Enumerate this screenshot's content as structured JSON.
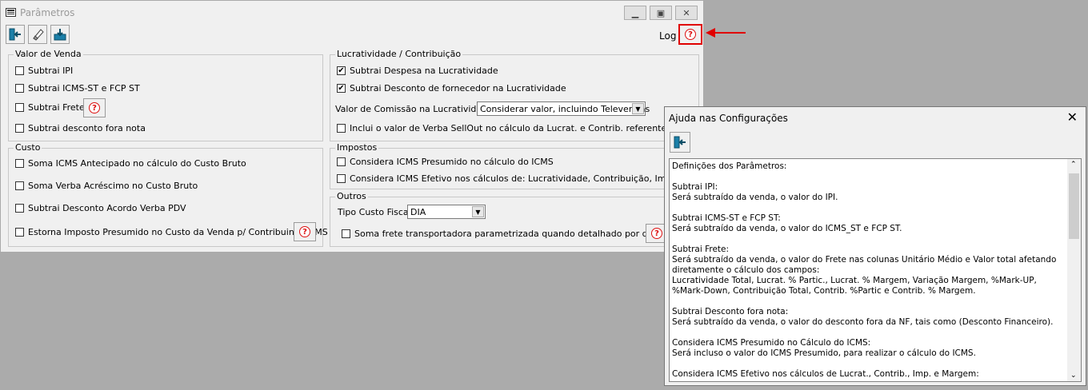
{
  "window": {
    "title": "Parâmetros"
  },
  "toolbar": {
    "log_label": "Log"
  },
  "venda": {
    "legend": "Valor de Venda",
    "items": [
      "Subtrai IPI",
      "Subtrai ICMS-ST e FCP ST",
      "Subtrai Frete",
      "Subtrai desconto fora nota"
    ]
  },
  "lucratividade": {
    "legend": "Lucratividade / Contribuição",
    "items": [
      "Subtrai Despesa na Lucratividade",
      "Subtrai Desconto de fornecedor na Lucratividade"
    ],
    "comissao_label": "Valor de Comissão na Lucratividade:",
    "comissao_value": "Considerar valor, incluindo Televendas",
    "verba_label": "Inclui o valor de Verba SellOut no cálculo da Lucrat. e Contrib. referente à Devolução"
  },
  "custo": {
    "legend": "Custo",
    "items": [
      "Soma ICMS Antecipado no cálculo do Custo Bruto",
      "Soma Verba Acréscimo no Custo Bruto",
      "Subtrai Desconto Acordo Verba PDV",
      "Estorna Imposto Presumido no Custo da Venda p/ Contribuinte ICMS"
    ]
  },
  "impostos": {
    "legend": "Impostos",
    "items": [
      "Considera ICMS Presumido no cálculo do ICMS",
      "Considera ICMS Efetivo nos cálculos de: Lucratividade, Contribuição, Imposto e Margem"
    ]
  },
  "outros": {
    "legend": "Outros",
    "tipo_label": "Tipo Custo Fiscal",
    "tipo_value": "DIA",
    "frete_label": "Soma frete transportadora parametrizada quando detalhado por documento"
  },
  "help_dialog": {
    "title": "Ajuda nas Configurações",
    "close": "✕",
    "text": "Definições dos Parâmetros:\n\nSubtrai IPI:\nSerá subtraído da venda, o valor do IPI.\n\nSubtrai ICMS-ST e FCP ST:\nSerá subtraído da venda, o valor do ICMS_ST e FCP ST.\n\nSubtrai Frete:\nSerá subtraído da venda, o valor do Frete nas colunas Unitário Médio e Valor total afetando diretamente o cálculo dos campos:\nLucratividade Total, Lucrat. % Partic., Lucrat. % Margem, Variação Margem, %Mark-UP, %Mark-Down, Contribuição Total, Contrib. %Partic e Contrib. % Margem.\n\nSubtrai Desconto fora nota:\nSerá subtraído da venda, o valor do desconto fora da NF, tais como (Desconto Financeiro).\n\nConsidera ICMS Presumido no Cálculo do ICMS:\nSerá incluso o valor do ICMS Presumido, para realizar o cálculo do ICMS.\n\nConsidera ICMS Efetivo nos cálculos de Lucrat., Contrib., Imp. e Margem:"
  },
  "colors": {
    "highlight": "#e00000",
    "arrow": "#e00000"
  },
  "icons": [
    "exit-icon",
    "eraser-icon",
    "save-icon",
    "help-icon",
    "minimize-icon",
    "maximize-icon",
    "close-icon"
  ]
}
